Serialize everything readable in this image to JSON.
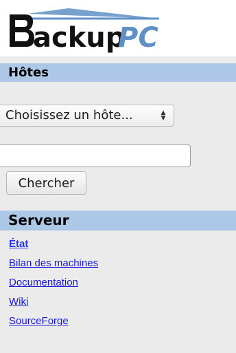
{
  "app": {
    "logo_text": "BackupPC"
  },
  "hosts": {
    "header": "Hôtes",
    "select_value": "Choisissez un hôte...",
    "search_value": "",
    "search_button": "Chercher"
  },
  "server": {
    "header": "Serveur",
    "links": [
      {
        "label": "État",
        "active": true
      },
      {
        "label": "Bilan des machines"
      },
      {
        "label": "Documentation"
      },
      {
        "label": "Wiki"
      },
      {
        "label": "SourceForge"
      }
    ]
  },
  "colors": {
    "header_bg": "#adc8e6",
    "sidebar_bg": "#ebebeb",
    "link": "#1818d8",
    "logo_dark": "#111111",
    "logo_accent": "#5e8fc6"
  }
}
